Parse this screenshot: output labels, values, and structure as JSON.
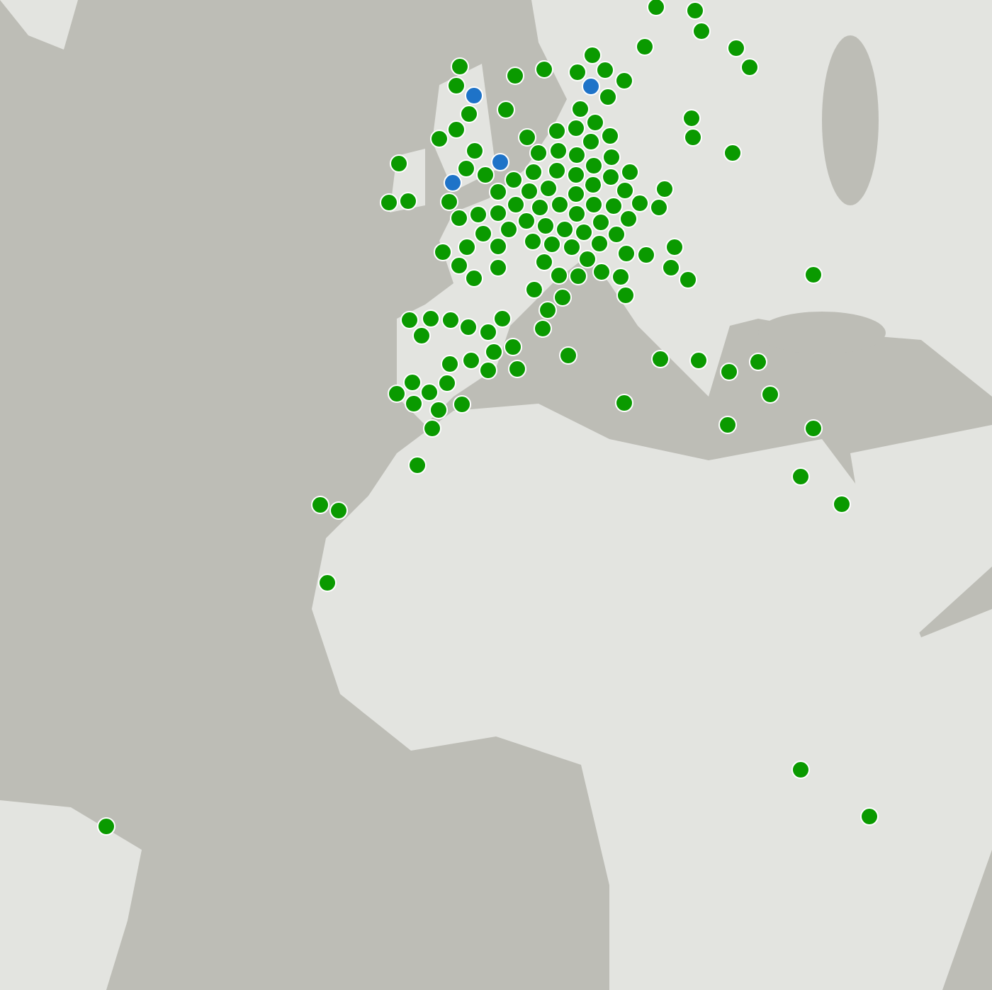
{
  "map": {
    "kind": "picture",
    "pins": [
      {
        "color": "#1e73c8"
      },
      {
        "color": "#1e73c8"
      },
      {
        "color": "#1e73c8"
      },
      {
        "color": "#1e73c8"
      },
      {
        "color": "#0a9a00"
      },
      {
        "color": "#0a9a00"
      },
      {
        "color": "#0a9a00"
      },
      {
        "color": "#0a9a00"
      },
      {
        "color": "#0a9a00"
      },
      {
        "color": "#0a9a00"
      },
      {
        "color": "#0a9a00"
      },
      {
        "color": "#0a9a00"
      },
      {
        "color": "#0a9a00"
      },
      {
        "color": "#0a9a00"
      },
      {
        "color": "#0a9a00"
      },
      {
        "color": "#0a9a00"
      },
      {
        "color": "#0a9a00"
      },
      {
        "color": "#0a9a00"
      },
      {
        "color": "#0a9a00"
      },
      {
        "color": "#0a9a00"
      },
      {
        "color": "#0a9a00"
      },
      {
        "color": "#0a9a00"
      },
      {
        "color": "#0a9a00"
      },
      {
        "color": "#0a9a00"
      },
      {
        "color": "#0a9a00"
      },
      {
        "color": "#0a9a00"
      },
      {
        "color": "#0a9a00"
      },
      {
        "color": "#0a9a00"
      },
      {
        "color": "#0a9a00"
      },
      {
        "color": "#0a9a00"
      },
      {
        "color": "#0a9a00"
      },
      {
        "color": "#0a9a00"
      },
      {
        "color": "#0a9a00"
      },
      {
        "color": "#0a9a00"
      },
      {
        "color": "#0a9a00"
      },
      {
        "color": "#0a9a00"
      },
      {
        "color": "#0a9a00"
      },
      {
        "color": "#0a9a00"
      },
      {
        "color": "#0a9a00"
      },
      {
        "color": "#0a9a00"
      },
      {
        "color": "#0a9a00"
      },
      {
        "color": "#0a9a00"
      },
      {
        "color": "#0a9a00"
      },
      {
        "color": "#0a9a00"
      },
      {
        "color": "#0a9a00"
      },
      {
        "color": "#0a9a00"
      },
      {
        "color": "#0a9a00"
      },
      {
        "color": "#0a9a00"
      },
      {
        "color": "#0a9a00"
      },
      {
        "color": "#0a9a00"
      },
      {
        "color": "#0a9a00"
      },
      {
        "color": "#0a9a00"
      },
      {
        "color": "#0a9a00"
      },
      {
        "color": "#0a9a00"
      },
      {
        "color": "#0a9a00"
      },
      {
        "color": "#0a9a00"
      },
      {
        "color": "#0a9a00"
      },
      {
        "color": "#0a9a00"
      },
      {
        "color": "#0a9a00"
      },
      {
        "color": "#0a9a00"
      },
      {
        "color": "#0a9a00"
      },
      {
        "color": "#0a9a00"
      },
      {
        "color": "#0a9a00"
      },
      {
        "color": "#0a9a00"
      },
      {
        "color": "#0a9a00"
      },
      {
        "color": "#0a9a00"
      },
      {
        "color": "#0a9a00"
      },
      {
        "color": "#0a9a00"
      },
      {
        "color": "#0a9a00"
      },
      {
        "color": "#0a9a00"
      },
      {
        "color": "#0a9a00"
      },
      {
        "color": "#0a9a00"
      },
      {
        "color": "#0a9a00"
      },
      {
        "color": "#0a9a00"
      },
      {
        "color": "#0a9a00"
      },
      {
        "color": "#0a9a00"
      },
      {
        "color": "#0a9a00"
      },
      {
        "color": "#0a9a00"
      },
      {
        "color": "#0a9a00"
      },
      {
        "color": "#0a9a00"
      },
      {
        "color": "#0a9a00"
      },
      {
        "color": "#0a9a00"
      },
      {
        "color": "#0a9a00"
      },
      {
        "color": "#0a9a00"
      },
      {
        "color": "#0a9a00"
      },
      {
        "color": "#0a9a00"
      },
      {
        "color": "#0a9a00"
      },
      {
        "color": "#0a9a00"
      },
      {
        "color": "#0a9a00"
      },
      {
        "color": "#0a9a00"
      },
      {
        "color": "#0a9a00"
      },
      {
        "color": "#0a9a00"
      },
      {
        "color": "#0a9a00"
      },
      {
        "color": "#0a9a00"
      },
      {
        "color": "#0a9a00"
      },
      {
        "color": "#0a9a00"
      },
      {
        "color": "#0a9a00"
      },
      {
        "color": "#0a9a00"
      },
      {
        "color": "#0a9a00"
      },
      {
        "color": "#0a9a00"
      },
      {
        "color": "#0a9a00"
      },
      {
        "color": "#0a9a00"
      },
      {
        "color": "#0a9a00"
      },
      {
        "color": "#0a9a00"
      },
      {
        "color": "#0a9a00"
      },
      {
        "color": "#0a9a00"
      },
      {
        "color": "#0a9a00"
      },
      {
        "color": "#0a9a00"
      },
      {
        "color": "#0a9a00"
      },
      {
        "color": "#0a9a00"
      },
      {
        "color": "#0a9a00"
      },
      {
        "color": "#0a9a00"
      },
      {
        "color": "#0a9a00"
      },
      {
        "color": "#0a9a00"
      },
      {
        "color": "#0a9a00"
      },
      {
        "color": "#0a9a00"
      },
      {
        "color": "#0a9a00"
      },
      {
        "color": "#0a9a00"
      },
      {
        "color": "#0a9a00"
      },
      {
        "color": "#0a9a00"
      },
      {
        "color": "#0a9a00"
      },
      {
        "color": "#0a9a00"
      },
      {
        "color": "#0a9a00"
      },
      {
        "color": "#0a9a00"
      },
      {
        "color": "#0a9a00"
      },
      {
        "color": "#0a9a00"
      },
      {
        "color": "#0a9a00"
      },
      {
        "color": "#0a9a00"
      },
      {
        "color": "#0a9a00"
      },
      {
        "color": "#0a9a00"
      },
      {
        "color": "#0a9a00"
      },
      {
        "color": "#0a9a00"
      },
      {
        "color": "#0a9a00"
      },
      {
        "color": "#0a9a00"
      },
      {
        "color": "#0a9a00"
      },
      {
        "color": "#0a9a00"
      },
      {
        "color": "#0a9a00"
      },
      {
        "color": "#0a9a00"
      },
      {
        "color": "#0a9a00"
      },
      {
        "color": "#0a9a00"
      },
      {
        "color": "#0a9a00"
      },
      {
        "color": "#0a9a00"
      },
      {
        "color": "#0a9a00"
      },
      {
        "color": "#0a9a00"
      }
    ]
  }
}
